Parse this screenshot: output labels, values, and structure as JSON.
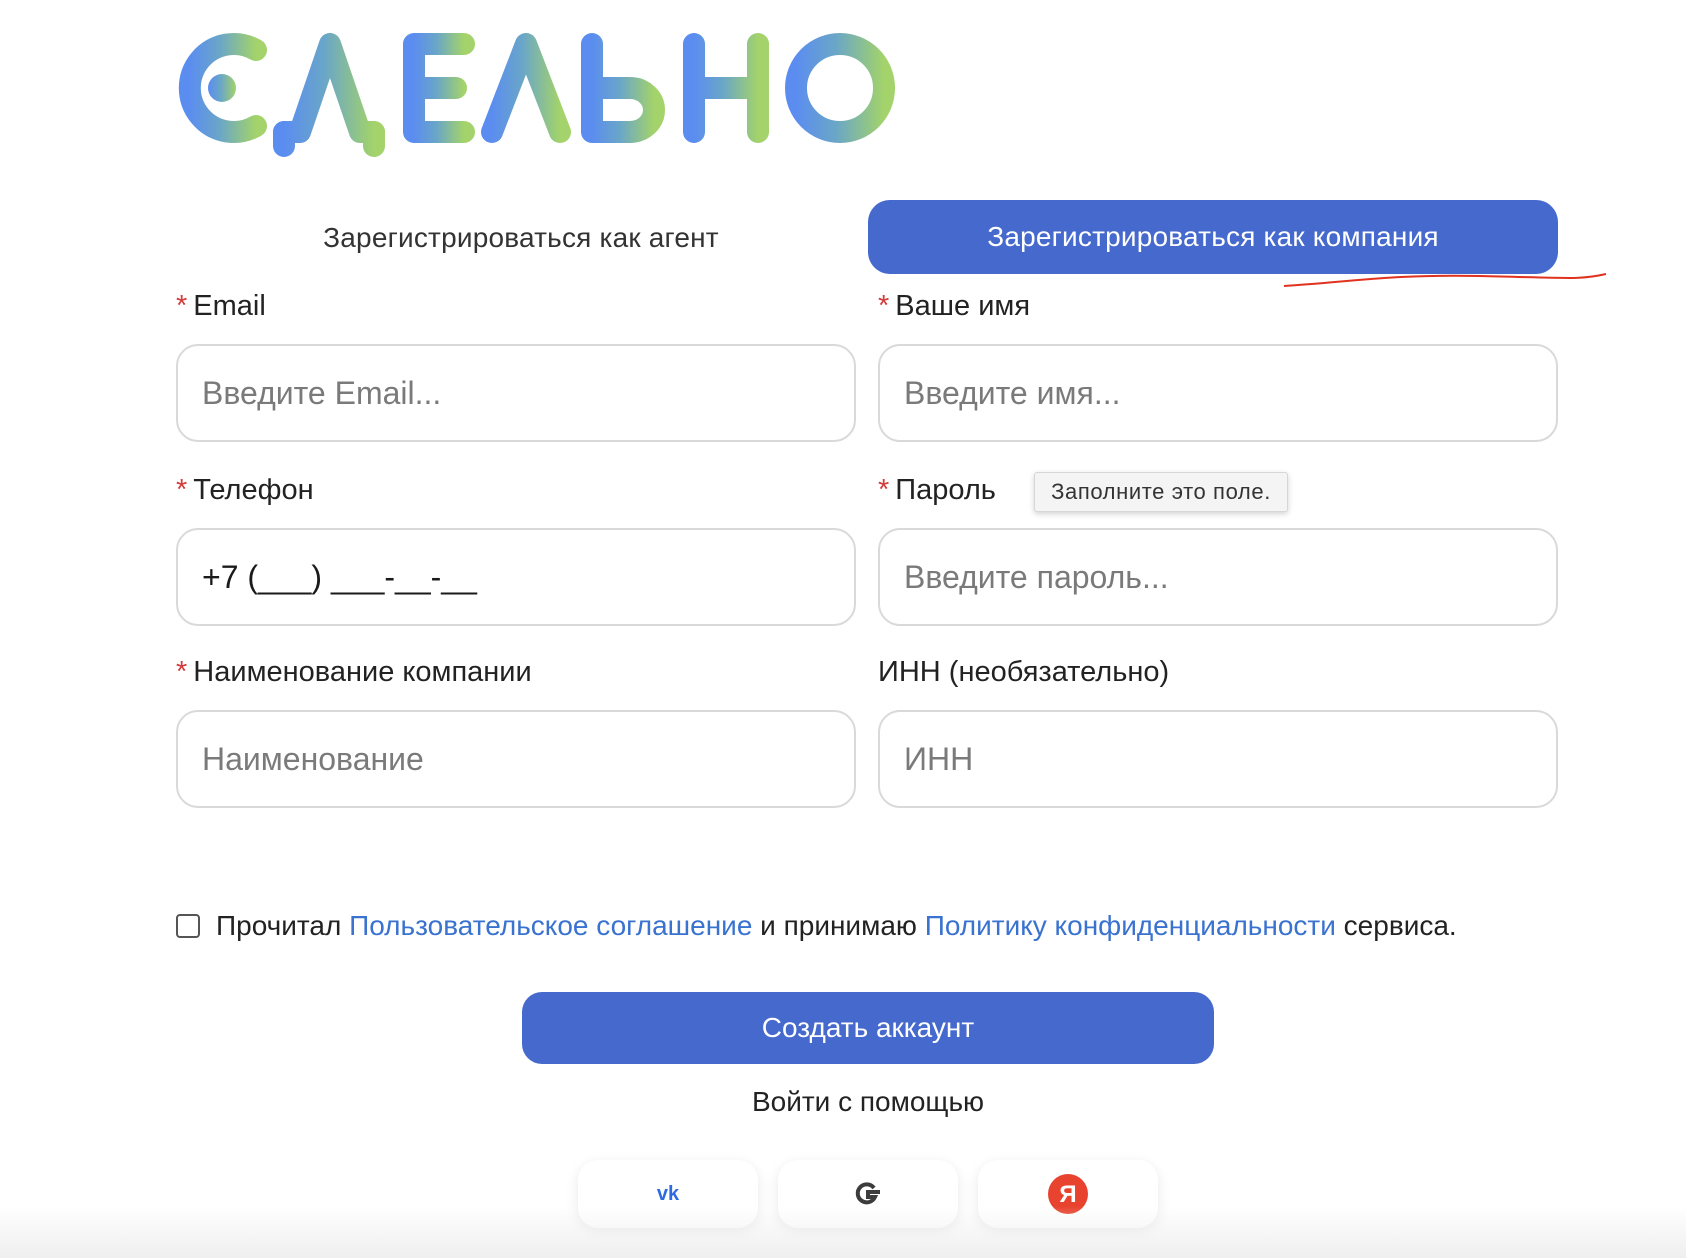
{
  "brand": {
    "logo_text": "СДЕЛЬНО"
  },
  "tabs": {
    "agent_label": "Зарегистрироваться как агент",
    "company_label": "Зарегистрироваться как компания",
    "active": "company"
  },
  "form": {
    "required_mark": "*",
    "email": {
      "label": "Email",
      "placeholder": "Введите Email...",
      "value": ""
    },
    "name": {
      "label": "Ваше имя",
      "placeholder": "Введите имя...",
      "value": ""
    },
    "phone": {
      "label": "Телефон",
      "value": "+7 (___) ___-__-__"
    },
    "password": {
      "label": "Пароль",
      "placeholder": "Введите пароль...",
      "value": ""
    },
    "company": {
      "label": "Наименование компании",
      "placeholder": "Наименование",
      "value": ""
    },
    "inn": {
      "label": "ИНН (необязательно)",
      "placeholder": "ИНН",
      "value": ""
    },
    "validation_tooltip": "Заполните это поле."
  },
  "consent": {
    "text_before": "Прочитал",
    "agreement_link": "Пользовательское соглашение",
    "text_middle": "и принимаю",
    "privacy_link": "Политику конфиденциальности",
    "text_after": "сервиса.",
    "checked": false
  },
  "submit": {
    "label": "Создать аккаунт"
  },
  "social_login": {
    "label": "Войти с помощью",
    "providers": [
      {
        "name": "vk",
        "icon": "vk-icon",
        "glyph": "vk",
        "color": "#2d6be0"
      },
      {
        "name": "google",
        "icon": "google-icon",
        "glyph": "G",
        "color": "#3c3c3c"
      },
      {
        "name": "yandex",
        "icon": "yandex-icon",
        "glyph": "Я",
        "color": "#ffffff",
        "bg": "#e8432e"
      }
    ]
  },
  "colors": {
    "primary": "#4569cc",
    "link": "#3a72cf",
    "required": "#d33a3a",
    "annotation": "#e0321f",
    "logo_gradient_start": "#5b8df0",
    "logo_gradient_end": "#9fd06a"
  }
}
